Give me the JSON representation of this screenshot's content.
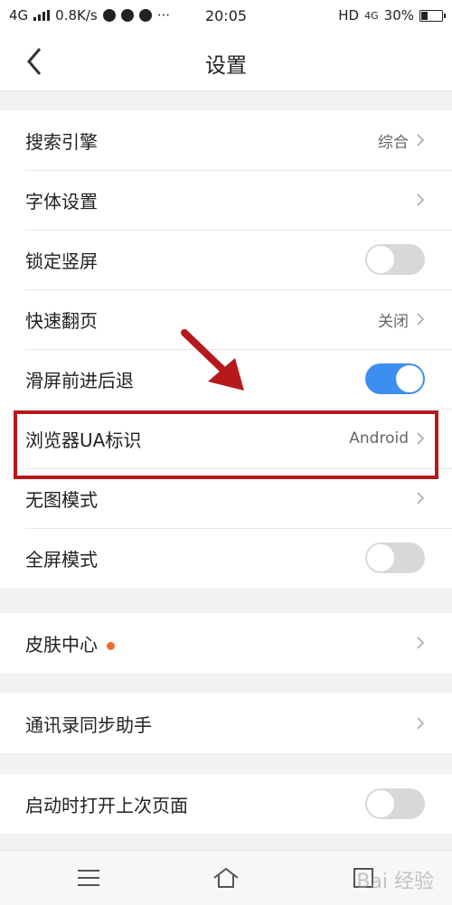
{
  "status_bar": {
    "network": "4G",
    "speed": "0.8K/s",
    "more": "···",
    "time": "20:05",
    "hd": "HD",
    "network_right": "4G",
    "battery": "30%"
  },
  "header": {
    "title": "设置",
    "back_icon": "chevron-left-icon"
  },
  "groups": {
    "main": [
      {
        "label": "搜索引擎",
        "value": "综合",
        "control": "chevron"
      },
      {
        "label": "字体设置",
        "value": "",
        "control": "chevron"
      },
      {
        "label": "锁定竖屏",
        "control": "toggle",
        "on": false
      },
      {
        "label": "快速翻页",
        "value": "关闭",
        "control": "chevron"
      },
      {
        "label": "滑屏前进后退",
        "control": "toggle",
        "on": true
      },
      {
        "label": "浏览器UA标识",
        "value": "Android",
        "control": "chevron"
      },
      {
        "label": "无图模式",
        "value": "",
        "control": "chevron"
      },
      {
        "label": "全屏模式",
        "control": "toggle",
        "on": false
      }
    ],
    "skin": [
      {
        "label": "皮肤中心",
        "control": "chevron",
        "badge": true
      }
    ],
    "contacts": [
      {
        "label": "通讯录同步助手",
        "control": "chevron"
      }
    ],
    "startup": [
      {
        "label": "启动时打开上次页面",
        "control": "toggle",
        "on": false
      }
    ]
  },
  "bottom_bar": {
    "icons": [
      "menu-icon",
      "home-icon",
      "tabs-icon"
    ],
    "watermark": "Bai 经验"
  },
  "colors": {
    "toggle_on": "#3c8ef1",
    "toggle_off": "#d8d8da",
    "badge": "#f26b2a",
    "highlight": "#b5191c"
  }
}
